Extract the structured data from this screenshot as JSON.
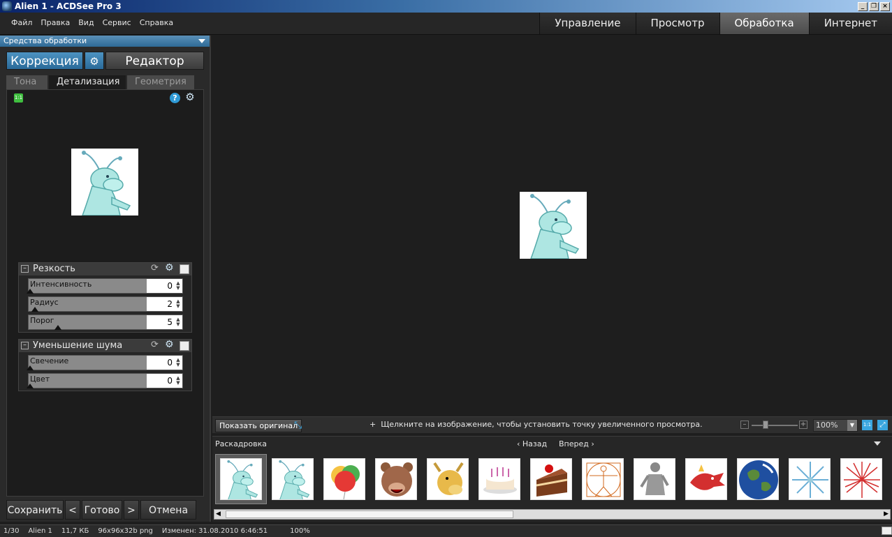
{
  "window": {
    "title": "Alien 1 - ACDSee Pro 3",
    "min": "_",
    "restore": "❐",
    "close": "×"
  },
  "menu": [
    "Файл",
    "Правка",
    "Вид",
    "Сервис",
    "Справка"
  ],
  "modes": [
    "Управление",
    "Просмотр",
    "Обработка",
    "Интернет"
  ],
  "left_panel": {
    "header": "Средства обработки",
    "tab_correction": "Коррекция",
    "tab_editor": "Редактор",
    "subtabs": [
      "Тона",
      "Детализация",
      "Геометрия"
    ],
    "icon_11": "1:1",
    "icon_help": "?",
    "sharpness": {
      "title": "Резкость",
      "sliders": [
        {
          "label": "Интенсивность",
          "value": "0"
        },
        {
          "label": "Радиус",
          "value": "2"
        },
        {
          "label": "Порог",
          "value": "5"
        }
      ]
    },
    "noise": {
      "title": "Уменьшение шума",
      "sliders": [
        {
          "label": "Свечение",
          "value": "0"
        },
        {
          "label": "Цвет",
          "value": "0"
        }
      ]
    },
    "buttons": {
      "save": "Сохранить",
      "prev": "<",
      "done": "Готово",
      "next": ">",
      "cancel": "Отмена"
    }
  },
  "viewer_toolbar": {
    "show_original": "Показать оригинал",
    "hint": "Щелкните на изображение, чтобы установить точку увеличенного просмотра.",
    "zoom_minus": "–",
    "zoom_plus": "+",
    "zoom": "100%",
    "btn_11": "1:1"
  },
  "filmstrip": {
    "title": "Раскадровка",
    "back": "Назад",
    "forward": "Вперед",
    "thumbnails": [
      "alien-1",
      "alien-2",
      "balloons",
      "bear",
      "moose",
      "cake",
      "cake-slice",
      "vitruvian-man",
      "david-statue",
      "dragon",
      "earth",
      "snowflake",
      "fireworks"
    ]
  },
  "status": {
    "index": "1/30",
    "name": "Alien 1",
    "size": "11,7 КБ",
    "dims": "96x96x32b png",
    "modified": "Изменен: 31.08.2010 6:46:51",
    "zoom": "100%"
  },
  "colors": {
    "accent": "#2e6a96",
    "active_mode": "#5a5a5a",
    "tool_blue": "#3aa6e0"
  },
  "icons": [
    "app-icon",
    "chevron-down-icon",
    "gear-icon",
    "help-icon",
    "one-to-one-icon",
    "reset-icon",
    "fit-icon",
    "fullscreen-icon"
  ]
}
